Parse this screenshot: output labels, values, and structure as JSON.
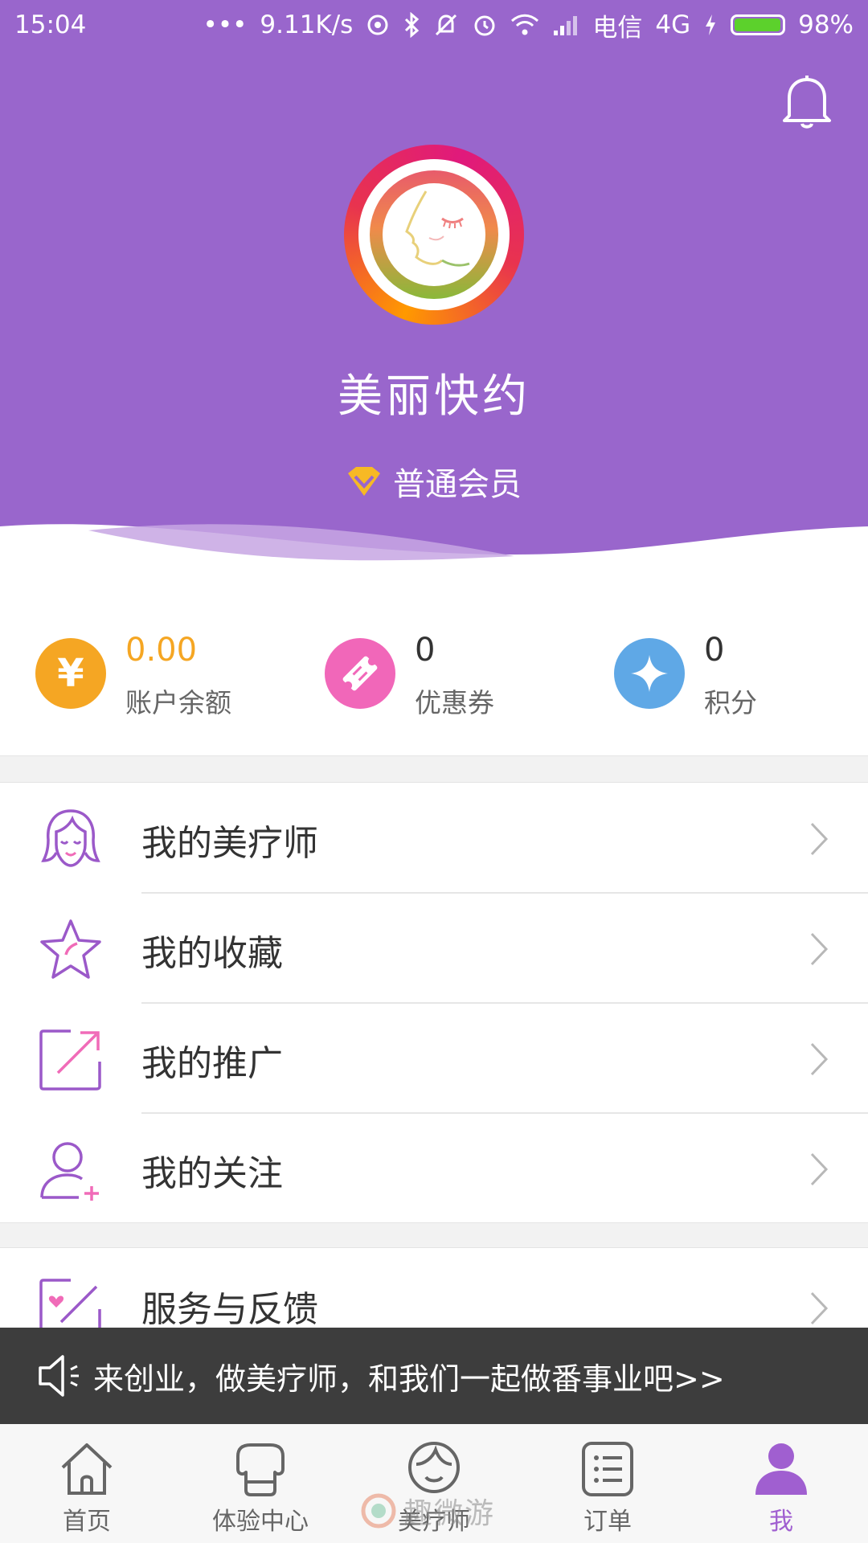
{
  "status_bar": {
    "time": "15:04",
    "dots": "•••",
    "network_speed": "9.11K/s",
    "carrier": "电信",
    "network_type": "4G",
    "battery_percent": "98%",
    "battery_level": 0.98
  },
  "header": {
    "username": "美丽快约",
    "member_level": "普通会员",
    "background_color": "#9966cc"
  },
  "stats": [
    {
      "value": "0.00",
      "label": "账户余额",
      "icon": "yuan-icon",
      "color": "#f5a623",
      "value_color": "#f5a623",
      "glyph": "¥"
    },
    {
      "value": "0",
      "label": "优惠券",
      "icon": "coupon-icon",
      "color": "#f167b9",
      "value_color": "#333333",
      "glyph": ""
    },
    {
      "value": "0",
      "label": "积分",
      "icon": "sparkle-icon",
      "color": "#5fa8e6",
      "value_color": "#333333",
      "glyph": ""
    }
  ],
  "menu": [
    {
      "label": "我的美疗师",
      "icon": "therapist-icon"
    },
    {
      "label": "我的收藏",
      "icon": "star-icon"
    },
    {
      "label": "我的推广",
      "icon": "share-icon"
    },
    {
      "label": "我的关注",
      "icon": "follow-user-icon"
    },
    {
      "label": "服务与反馈",
      "icon": "feedback-icon"
    }
  ],
  "banner": {
    "text": "来创业，做美疗师，和我们一起做番事业吧>>"
  },
  "tabs": [
    {
      "label": "首页",
      "icon": "home-icon"
    },
    {
      "label": "体验中心",
      "icon": "experience-center-icon"
    },
    {
      "label": "美疗师",
      "icon": "therapist-tab-icon"
    },
    {
      "label": "订单",
      "icon": "order-list-icon"
    },
    {
      "label": "我",
      "icon": "profile-icon",
      "active": true
    }
  ],
  "watermark": {
    "text": "趣微游"
  }
}
